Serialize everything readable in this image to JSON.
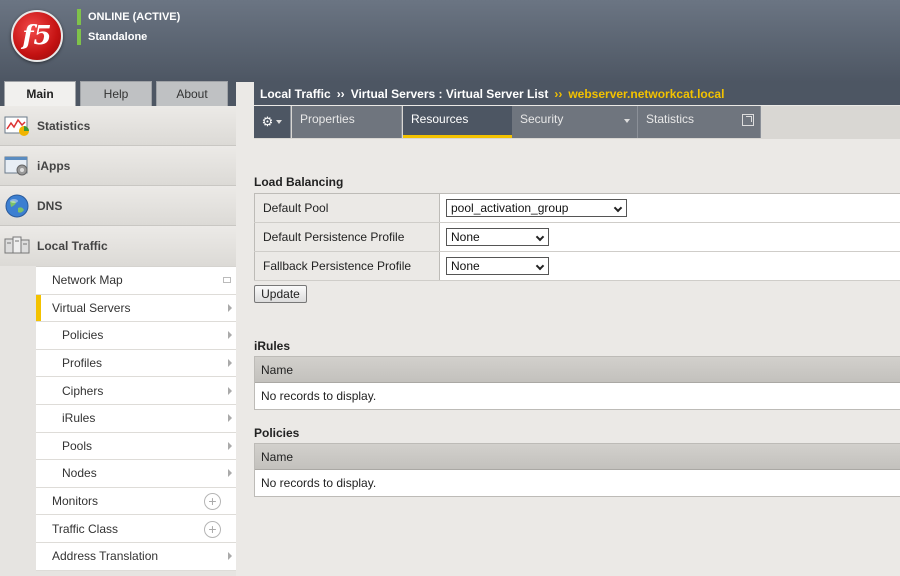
{
  "header": {
    "logo_text": "f5",
    "status": "ONLINE (ACTIVE)",
    "mode": "Standalone",
    "colors": {
      "header_bg": "#4d5663",
      "status_green": "#7fc24a",
      "accent": "#f3c200"
    }
  },
  "nav_tabs": [
    {
      "label": "Main",
      "active": true
    },
    {
      "label": "Help",
      "active": false
    },
    {
      "label": "About",
      "active": false
    }
  ],
  "sidebar": {
    "sections": [
      {
        "label": "Statistics",
        "icon": "statistics-icon"
      },
      {
        "label": "iApps",
        "icon": "iapps-icon"
      },
      {
        "label": "DNS",
        "icon": "globe-icon"
      },
      {
        "label": "Local Traffic",
        "icon": "local-traffic-icon"
      }
    ],
    "submenu": [
      {
        "label": "Network Map",
        "indent": false,
        "marker": "map"
      },
      {
        "label": "Virtual Servers",
        "indent": false,
        "marker": "arrow",
        "selected": true
      },
      {
        "label": "Policies",
        "indent": true,
        "marker": "arrow"
      },
      {
        "label": "Profiles",
        "indent": true,
        "marker": "arrow"
      },
      {
        "label": "Ciphers",
        "indent": true,
        "marker": "arrow"
      },
      {
        "label": "iRules",
        "indent": true,
        "marker": "arrow"
      },
      {
        "label": "Pools",
        "indent": true,
        "marker": "arrow"
      },
      {
        "label": "Nodes",
        "indent": true,
        "marker": "arrow"
      },
      {
        "label": "Monitors",
        "indent": false,
        "marker": "plus"
      },
      {
        "label": "Traffic Class",
        "indent": false,
        "marker": "plus"
      },
      {
        "label": "Address Translation",
        "indent": false,
        "marker": "arrow"
      }
    ]
  },
  "breadcrumb": {
    "part1": "Local Traffic",
    "sep": "››",
    "part2": "Virtual Servers : Virtual Server List",
    "current": "webserver.networkcat.local"
  },
  "subtabs": [
    {
      "label": "Properties",
      "active": false
    },
    {
      "label": "Resources",
      "active": true
    },
    {
      "label": "Security",
      "active": false
    },
    {
      "label": "Statistics",
      "active": false
    }
  ],
  "load_balancing": {
    "title": "Load Balancing",
    "rows": [
      {
        "label": "Default Pool",
        "value": "pool_activation_group"
      },
      {
        "label": "Default Persistence Profile",
        "value": "None"
      },
      {
        "label": "Fallback Persistence Profile",
        "value": "None"
      }
    ],
    "update_label": "Update"
  },
  "irules": {
    "title": "iRules",
    "column": "Name",
    "empty": "No records to display."
  },
  "policies": {
    "title": "Policies",
    "column": "Name",
    "empty": "No records to display."
  }
}
